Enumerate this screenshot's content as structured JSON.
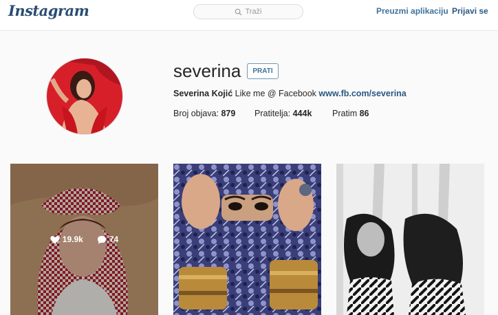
{
  "header": {
    "logo": "Instagram",
    "search_placeholder": "Traži",
    "download_link": "Preuzmi aplikaciju",
    "login_link": "Prijavi se"
  },
  "profile": {
    "username": "severina",
    "follow_label": "PRATI",
    "full_name": "Severina Kojić",
    "bio_text": " Like me @ Facebook ",
    "bio_link": "www.fb.com/severina",
    "stats": {
      "posts_label": "Broj objava: ",
      "posts_value": "879",
      "followers_label": "Pratitelja: ",
      "followers_value": "444k",
      "following_label": "Pratim ",
      "following_value": "86"
    }
  },
  "posts": [
    {
      "likes": "19.9k",
      "comments": "74"
    },
    {},
    {}
  ],
  "colors": {
    "link_blue": "#3f729b",
    "dark_blue": "#2a5883",
    "background": "#fafafa"
  },
  "icons": [
    "search-icon",
    "heart-icon",
    "comment-icon"
  ]
}
